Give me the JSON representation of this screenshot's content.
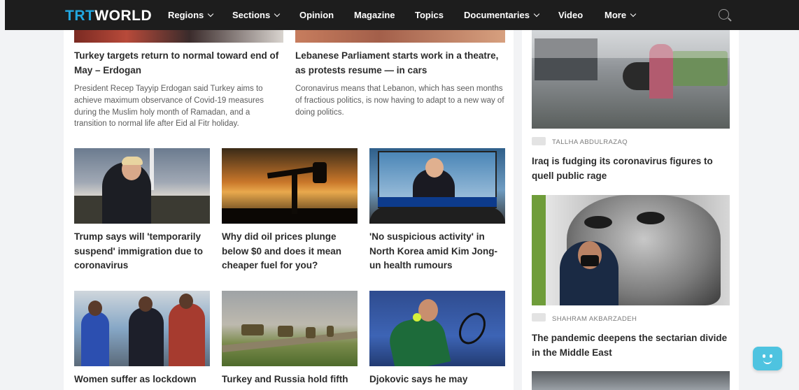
{
  "nav": {
    "logo_trt": "TRT",
    "logo_world": "WORLD",
    "items": [
      {
        "label": "Regions",
        "dropdown": true
      },
      {
        "label": "Sections",
        "dropdown": true
      },
      {
        "label": "Opinion",
        "dropdown": false
      },
      {
        "label": "Magazine",
        "dropdown": false
      },
      {
        "label": "Topics",
        "dropdown": false
      },
      {
        "label": "Documentaries",
        "dropdown": true
      },
      {
        "label": "Video",
        "dropdown": false
      },
      {
        "label": "More",
        "dropdown": true
      }
    ],
    "search_icon": "search-icon"
  },
  "main": {
    "featured": [
      {
        "title": "Turkey targets return to normal toward end of May – Erdogan",
        "summary": "President Recep Tayyip Erdogan said Turkey aims to achieve maximum observance of Covid-19 measures during the Muslim holy month of Ramadan, and a transition to normal life after Eid al Fitr holiday."
      },
      {
        "title": "Lebanese Parliament starts work in a theatre, as protests resume — in cars",
        "summary": "Coronavirus means that Lebanon, which has seen months of fractious politics, is now having to adapt to a new way of doing politics."
      }
    ],
    "grid": [
      {
        "title": "Trump says will 'temporarily suspend' immigration due to coronavirus"
      },
      {
        "title": "Why did oil prices plunge below $0 and does it mean cheaper fuel for you?"
      },
      {
        "title": "'No suspicious activity' in North Korea amid Kim Jong-un health rumours"
      },
      {
        "title": "Women suffer as lockdown"
      },
      {
        "title": "Turkey and Russia hold fifth"
      },
      {
        "title": "Djokovic says he may"
      }
    ]
  },
  "sidebar": {
    "articles": [
      {
        "author": "TALLHA ABDULRAZAQ",
        "title": "Iraq is fudging its coronavirus figures to quell public rage"
      },
      {
        "author": "SHAHRAM AKBARZADEH",
        "title": "The pandemic deepens the sectarian divide in the Middle East"
      }
    ]
  },
  "colors": {
    "nav_bg": "#1d1d1d",
    "logo_accent": "#22a7e0",
    "chat_button": "#4ec3e0",
    "page_bg": "#f2f3f5"
  }
}
